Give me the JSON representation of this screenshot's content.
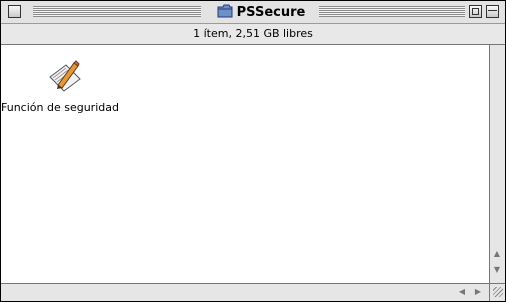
{
  "window": {
    "title": "PSSecure",
    "info": "1 ítem, 2,51 GB libres"
  },
  "files": [
    {
      "label": "Función de seguridad",
      "icon": "document-pencil-icon"
    }
  ],
  "colors": {
    "titlebar": "#e3e3e3",
    "content_bg": "#ffffff",
    "scrollbar": "#e6e6e6"
  }
}
